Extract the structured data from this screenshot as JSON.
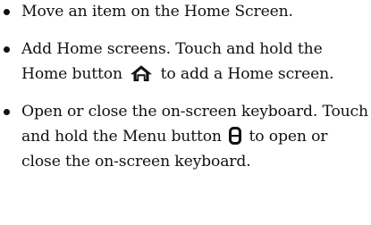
{
  "items": [
    {
      "text": "Move an item on the Home Screen."
    },
    {
      "text_before": "Add Home screens. Touch and hold the Home button",
      "icon": "home-icon",
      "text_after": "to add a Home screen."
    },
    {
      "text_before": "Open or close the on-screen keyboard. Touch and hold the Menu button",
      "icon": "menu-button-icon",
      "text_after": "to open or close the on-screen keyboard."
    }
  ]
}
